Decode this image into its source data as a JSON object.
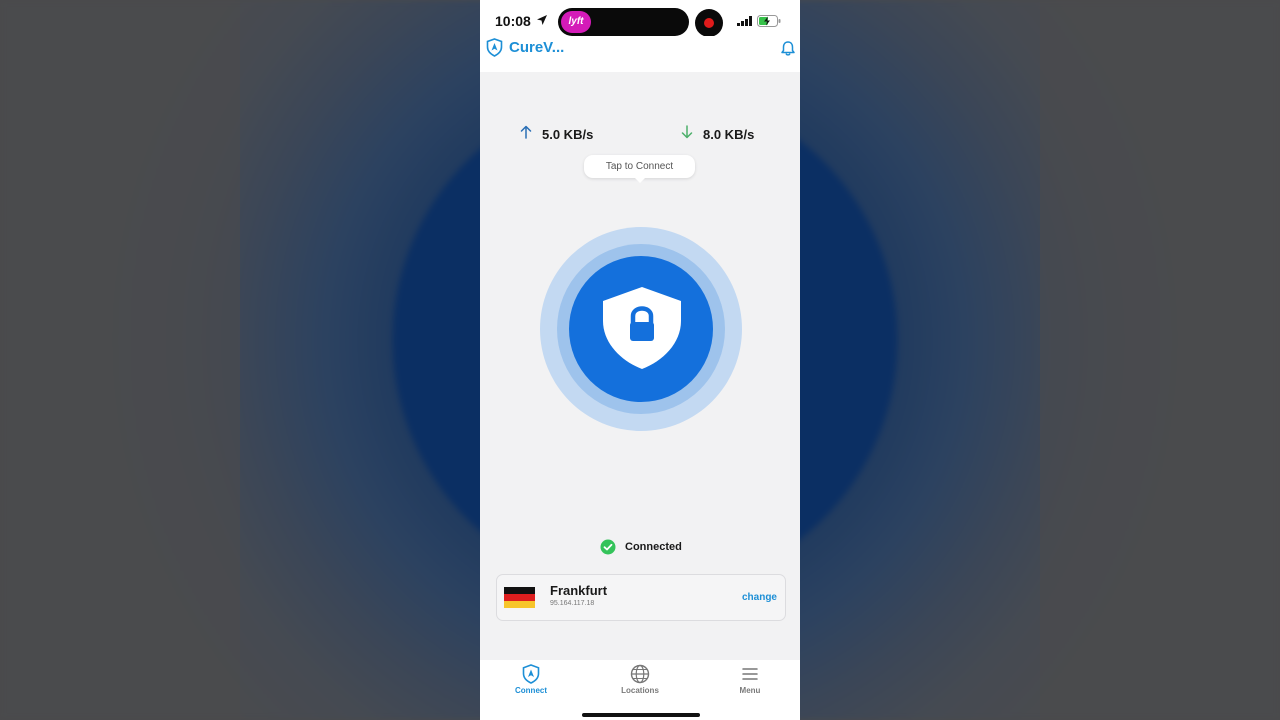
{
  "status_bar": {
    "time": "10:08",
    "live_activity": "lyft"
  },
  "app": {
    "title": "CureV...",
    "accent_color": "#1d8fd6"
  },
  "speeds": {
    "upload": "5.0 KB/s",
    "download": "8.0 KB/s"
  },
  "connect": {
    "tooltip": "Tap to Connect",
    "status": "Connected",
    "button_color": "#1470dc"
  },
  "location": {
    "city": "Frankfurt",
    "ip": "95.164.117.18",
    "change_label": "change",
    "flag": "germany-flag"
  },
  "tabs": [
    {
      "label": "Connect",
      "icon": "shield-nav-icon",
      "active": true
    },
    {
      "label": "Locations",
      "icon": "globe-icon",
      "active": false
    },
    {
      "label": "Menu",
      "icon": "hamburger-icon",
      "active": false
    }
  ]
}
